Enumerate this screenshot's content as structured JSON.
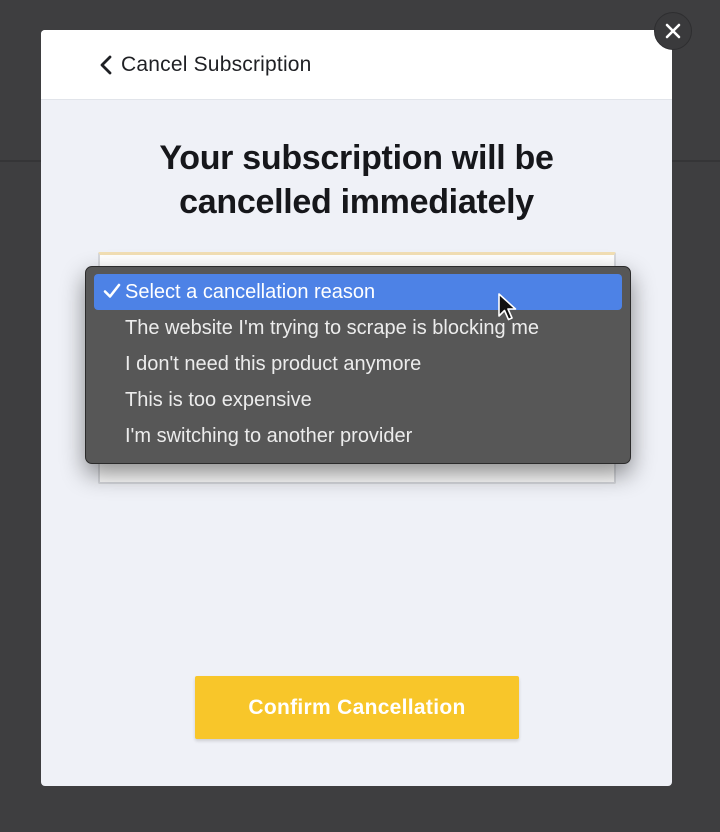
{
  "modal": {
    "back_label": "Cancel Subscription",
    "title": "Your subscription will be cancelled immediately",
    "confirm_label": "Confirm Cancellation"
  },
  "dropdown": {
    "selected_index": 0,
    "options": [
      {
        "label": "Select a cancellation reason"
      },
      {
        "label": "The website I'm trying to scrape is blocking me"
      },
      {
        "label": "I don't need this product anymore"
      },
      {
        "label": "This is too expensive"
      },
      {
        "label": "I'm switching to another provider"
      }
    ]
  },
  "icons": {
    "close": "close-icon",
    "back": "chevron-left-icon",
    "check": "checkmark-icon",
    "cursor": "mouse-pointer-icon"
  },
  "colors": {
    "accent": "#f8c62a",
    "selection": "#4d82e6",
    "overlay": "#3e3e40"
  }
}
